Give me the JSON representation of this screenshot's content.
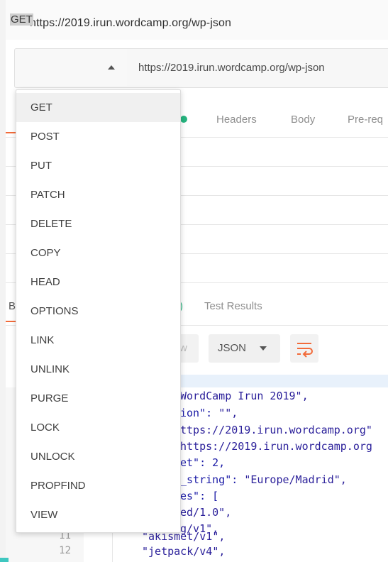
{
  "window": {
    "title": "https://2019.irun.wordcamp.org/wp-json"
  },
  "request": {
    "method": "GET",
    "url": "https://2019.irun.wordcamp.org/wp-json"
  },
  "tabs": {
    "headers": "Headers",
    "body": "Body",
    "prereq": "Pre-req"
  },
  "methods": [
    "GET",
    "POST",
    "PUT",
    "PATCH",
    "DELETE",
    "COPY",
    "HEAD",
    "OPTIONS",
    "LINK",
    "UNLINK",
    "PURGE",
    "LOCK",
    "UNLOCK",
    "PROPFIND",
    "VIEW"
  ],
  "response": {
    "count_fragment": ")",
    "test_results": "Test Results",
    "pretty_fragment": "w",
    "format": "JSON",
    "prefix_b": "B"
  },
  "code": {
    "line_numbers": [
      "11",
      "12"
    ],
    "lines": [
      {
        "k": "WordCamp Irun 2019\",",
        "v": ""
      },
      {
        "k": "ion\": ",
        "v": "\"\","
      },
      {
        "k": "ttps://2019.irun.wordcamp.org\"",
        "v": ""
      },
      {
        "k": "https://2019.irun.wordcamp.org",
        "v": ""
      },
      {
        "k": "et\": 2,",
        "v": ""
      },
      {
        "k": "_string\": ",
        "v": "\"Europe/Madrid\","
      },
      {
        "k": "es\": [",
        "v": ""
      },
      {
        "k": "ed/1.0\",",
        "v": ""
      },
      {
        "k": "g/v1\",",
        "v": ""
      },
      {
        "k": "\"akismet/v1\",",
        "v": ""
      },
      {
        "k": "\"jetpack/v4\",",
        "v": ""
      }
    ]
  },
  "colors": {
    "accent": "#f26b3a",
    "status_dot": "#26b47f"
  }
}
